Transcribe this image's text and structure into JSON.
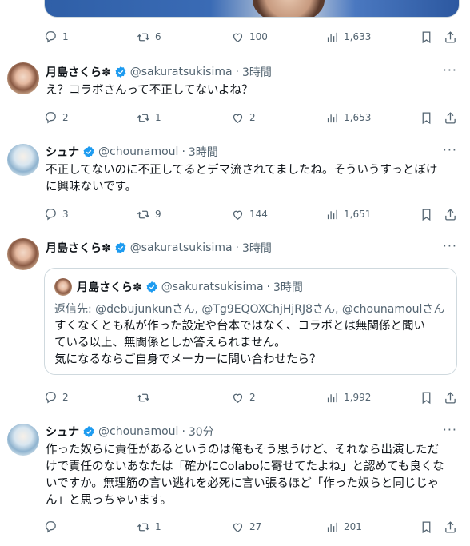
{
  "tweets": [
    {
      "actions": {
        "replies": "1",
        "retweets": "6",
        "likes": "100",
        "views": "1,633"
      }
    },
    {
      "author": {
        "name": "月島さくら✽",
        "handle": "@sakuratsukisima",
        "time": "3時間"
      },
      "text": "え？コラボさんって不正してないよね？",
      "actions": {
        "replies": "2",
        "retweets": "1",
        "likes": "2",
        "views": "1,653"
      }
    },
    {
      "author": {
        "name": "シュナ",
        "handle": "@chounamoul",
        "time": "3時間"
      },
      "text_line1": "不正してないのに不正してるとデマ流されてましたね。そういうすっとぼけ",
      "text_line2": "に興味ないです。",
      "actions": {
        "replies": "3",
        "retweets": "9",
        "likes": "144",
        "views": "1,651"
      }
    },
    {
      "author": {
        "name": "月島さくら✽",
        "handle": "@sakuratsukisima",
        "time": "3時間"
      },
      "quote": {
        "author": {
          "name": "月島さくら✽",
          "handle": "@sakuratsukisima",
          "time": "3時間"
        },
        "reply_prefix": "返信先: ",
        "reply_mentions": "@debujunkunさん, @Tg9EQOXChjHjRJ8さん, @chounamoulさん",
        "text_line1": "すくなくとも私が作った設定や台本ではなく、コラボとは無関係と聞い",
        "text_line2": "ている以上、無関係としか答えられません。",
        "text_line3": "気になるならご自身でメーカーに問い合わせたら？"
      },
      "actions": {
        "replies": "2",
        "retweets": "",
        "likes": "2",
        "views": "1,992"
      }
    },
    {
      "author": {
        "name": "シュナ",
        "handle": "@chounamoul",
        "time": "30分"
      },
      "text_line1": "作った奴らに責任があるというのは俺もそう思うけど、それなら出演しただ",
      "text_line2": "けで責任のないあなたは「確かにColaboに寄せてたよね」と認めても良くな",
      "text_line3": "いですか。無理筋の言い逃れを必死に言い張るほど「作った奴らと同じじゃ",
      "text_line4": "ん」と思っちゃいます。",
      "actions": {
        "replies": "",
        "retweets": "1",
        "likes": "27",
        "views": "201"
      }
    }
  ],
  "ui": {
    "separator": "·",
    "more": "···"
  },
  "colors": {
    "verified": "#1d9bf0",
    "muted": "#536471",
    "text": "#0f1419",
    "border": "#cfd9de"
  }
}
